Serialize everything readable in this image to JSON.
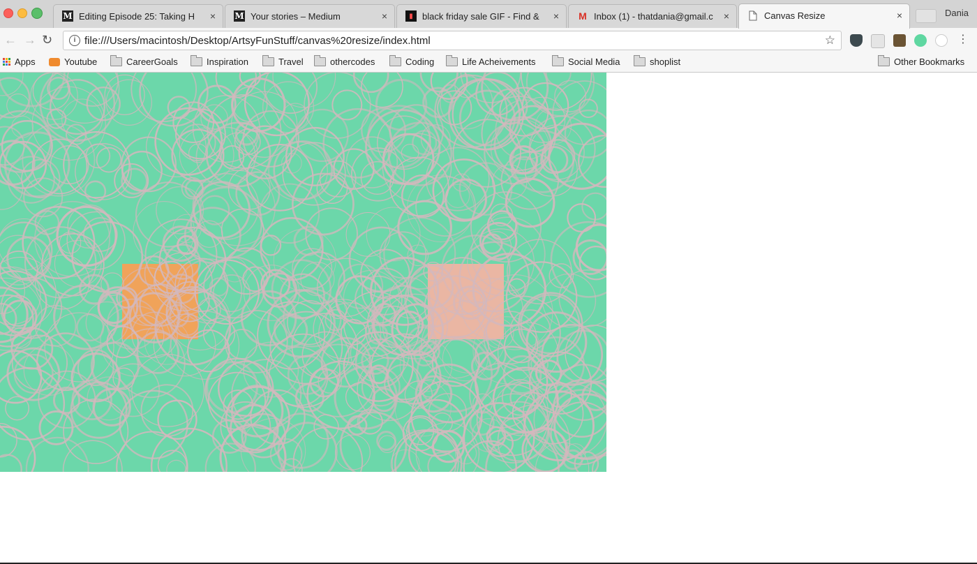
{
  "browser": {
    "tabs": [
      {
        "title": "Editing Episode 25: Taking H",
        "favicon": "medium-m-icon",
        "active": false
      },
      {
        "title": "Your stories – Medium",
        "favicon": "medium-m-icon",
        "active": false
      },
      {
        "title": "black friday sale GIF - Find &",
        "favicon": "gif-file-icon",
        "active": false
      },
      {
        "title": "Inbox (1) - thatdania@gmail.c",
        "favicon": "gmail-icon",
        "active": false
      },
      {
        "title": "Canvas Resize",
        "favicon": "document-icon",
        "active": true
      }
    ],
    "tab_close_glyph": "×",
    "profile_name": "Dania",
    "url": "file:///Users/macintosh/Desktop/ArtsyFunStuff/canvas%20resize/index.html",
    "bookmarks": [
      {
        "label": "Apps",
        "icon": "apps-grid-icon"
      },
      {
        "label": "Youtube",
        "icon": "youtube-icon"
      },
      {
        "label": "CareerGoals",
        "icon": "folder-icon"
      },
      {
        "label": "Inspiration",
        "icon": "folder-icon"
      },
      {
        "label": "Travel",
        "icon": "folder-icon"
      },
      {
        "label": "othercodes",
        "icon": "folder-icon"
      },
      {
        "label": "Coding",
        "icon": "folder-icon"
      },
      {
        "label": "Life Acheivements",
        "icon": "folder-icon"
      },
      {
        "label": "Social Media",
        "icon": "folder-icon"
      },
      {
        "label": "shoplist",
        "icon": "folder-icon"
      }
    ],
    "other_bookmarks": "Other Bookmarks"
  },
  "page": {
    "canvas": {
      "background_color": "#6cd7aa",
      "circle_stroke_color": "#d3b8bd",
      "squares": [
        {
          "name": "orange-square",
          "color": "#f0a35a"
        },
        {
          "name": "pink-square",
          "color": "#eab6a3"
        }
      ]
    }
  }
}
